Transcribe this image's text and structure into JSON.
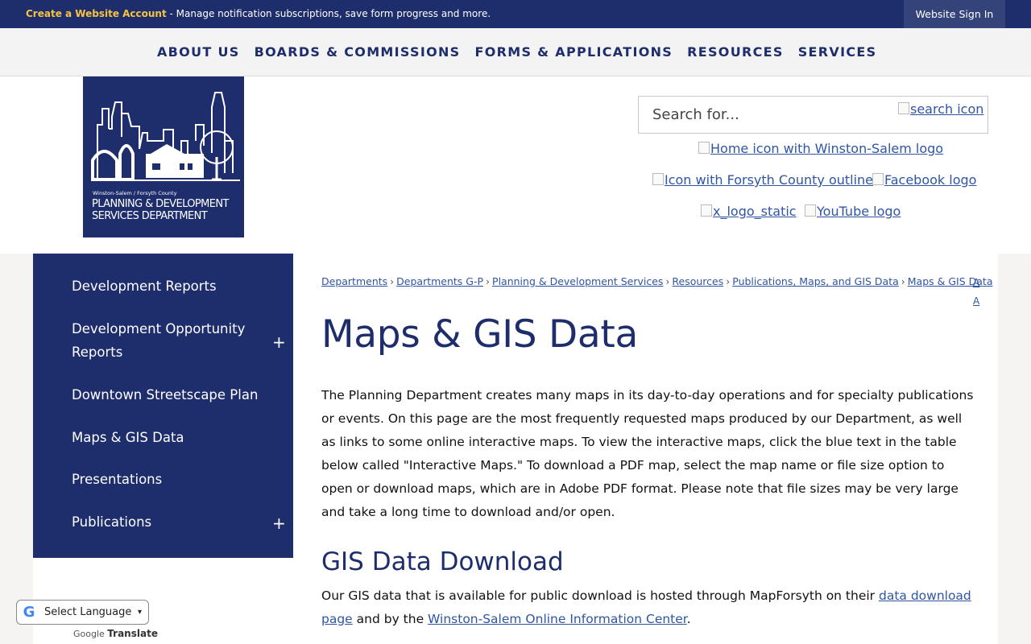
{
  "topbar": {
    "create_account": "Create a Website Account",
    "message": " - Manage notification subscriptions, save form progress and more.",
    "sign_in": "Website Sign In"
  },
  "nav": {
    "items": [
      "ABOUT US",
      "BOARDS & COMMISSIONS",
      "FORMS & APPLICATIONS",
      "RESOURCES",
      "SERVICES"
    ]
  },
  "logo": {
    "line1": "Winston-Salem / Forsyth County",
    "line2": "PLANNING & DEVELOPMENT",
    "line3": "SERVICES DEPARTMENT"
  },
  "search": {
    "placeholder": "Search for...",
    "icon_alt": "search icon"
  },
  "social": {
    "home": "Home icon with Winston-Salem logo",
    "county": "Icon with Forsyth County outline",
    "facebook": "Facebook logo",
    "x": "x_logo_static",
    "youtube": "YouTube logo"
  },
  "sidebar": {
    "items": [
      {
        "label": "Development Reports"
      },
      {
        "label": "Development Opportunity Reports"
      },
      {
        "label": "Downtown Streetscape Plan"
      },
      {
        "label": "Maps & GIS Data"
      },
      {
        "label": "Presentations"
      },
      {
        "label": "Publications"
      }
    ],
    "expand_symbol": "+"
  },
  "breadcrumb": [
    "Departments",
    "Departments G-P",
    "Planning & Development Services",
    "Resources",
    "Publications, Maps, and GIS Data",
    "Maps & GIS Data"
  ],
  "breadcrumb_sep": "›",
  "text_size": {
    "a1": "A",
    "a2": "A"
  },
  "page": {
    "title": "Maps & GIS Data",
    "intro": "The Planning Department creates many maps in its day-to-day operations and for specialty publications or events. On this page are the most frequently requested maps produced by our Department, as well as links to some online interactive maps. To view the interactive maps, click the blue text in the table below called \"Interactive Maps.\" To download a PDF map, select the map name or file size option to open or download maps, which are in Adobe PDF format. Please note that file sizes may be very large and take a long time to download and/or open.",
    "gis_heading": "GIS Data Download",
    "gis_text_1": "Our GIS data that is available for public download is hosted through MapForsyth on their ",
    "gis_link_1": "data download page",
    "gis_text_2": " and by the ",
    "gis_link_2": "Winston-Salem Online Information Center",
    "gis_text_3": "."
  },
  "translate": {
    "g": "G",
    "select_label": "Select Language",
    "caret": "▾",
    "powered": "Google",
    "translate_word": "Translate"
  }
}
